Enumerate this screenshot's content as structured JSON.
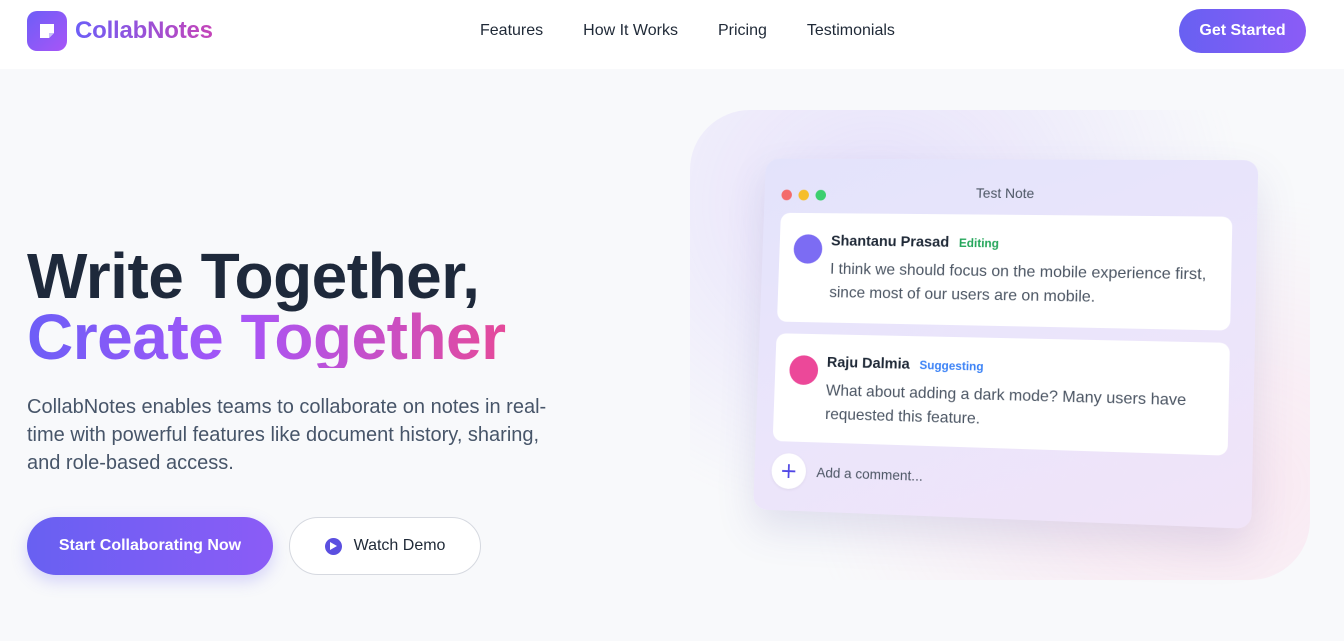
{
  "brand": {
    "name": "CollabNotes",
    "logo_icon": "sticky-note-icon",
    "accent": "#6d5ef7"
  },
  "nav": {
    "links": [
      "Features",
      "How It Works",
      "Pricing",
      "Testimonials"
    ],
    "cta_label": "Get Started"
  },
  "hero": {
    "title_line1": "Write Together,",
    "title_line2": "Create Together",
    "description": "CollabNotes enables teams to collaborate on notes in real-time with powerful features like document history, sharing, and role-based access.",
    "primary_cta": "Start Collaborating Now",
    "secondary_cta": "Watch Demo",
    "secondary_icon": "play-icon"
  },
  "note": {
    "title": "Test Note",
    "window_controls": [
      "red",
      "yellow",
      "green"
    ],
    "comments": [
      {
        "author": "Shantanu Prasad",
        "status": "Editing",
        "status_color": "#22a559",
        "text": "I think we should focus on the mobile experience first, since most of our users are on mobile."
      },
      {
        "author": "Raju Dalmia",
        "status": "Suggesting",
        "status_color": "#3b82f6",
        "text": "What about adding a dark mode? Many users have requested this feature."
      }
    ],
    "add_comment_placeholder": "Add a comment...",
    "add_icon": "plus-icon"
  }
}
